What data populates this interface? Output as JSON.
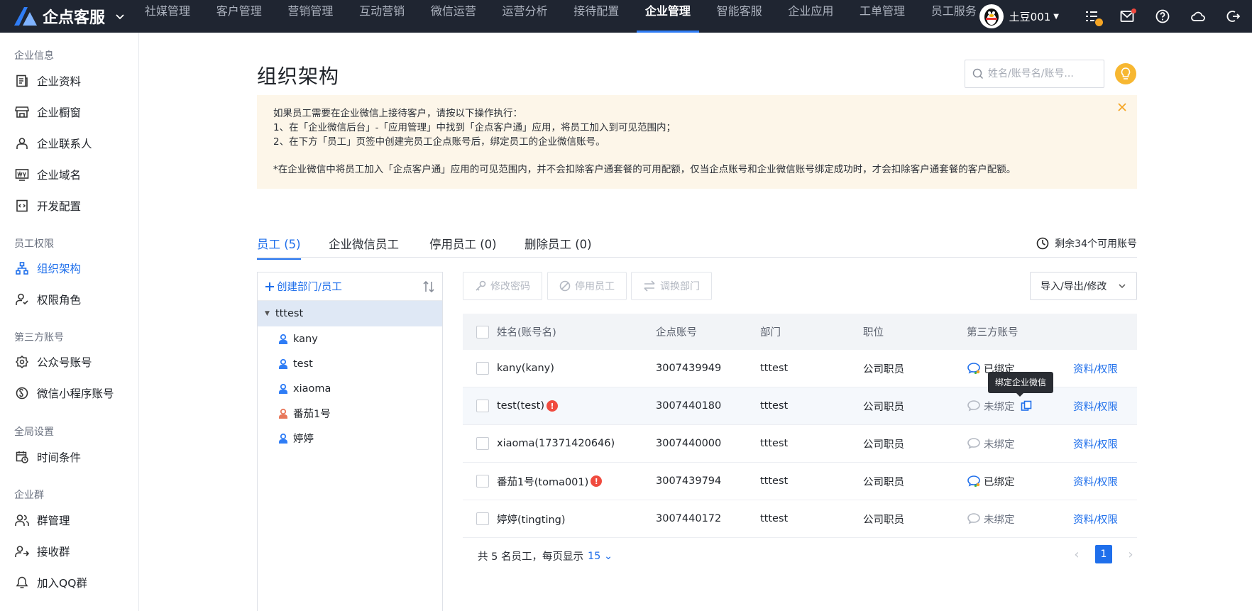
{
  "app": {
    "name": "企点客服"
  },
  "nav": {
    "items": [
      "社媒管理",
      "客户管理",
      "营销管理",
      "互动营销",
      "微信运营",
      "运营分析",
      "接待配置",
      "企业管理",
      "智能客服",
      "企业应用",
      "工单管理",
      "员工服务"
    ],
    "active": "企业管理",
    "username": "土豆001"
  },
  "sidebar": {
    "groups": [
      {
        "title": "企业信息",
        "items": [
          {
            "label": "企业资料",
            "icon": "document-icon"
          },
          {
            "label": "企业橱窗",
            "icon": "storefront-icon"
          },
          {
            "label": "企业联系人",
            "icon": "contact-person-icon"
          },
          {
            "label": "企业域名",
            "icon": "domain-icon"
          },
          {
            "label": "开发配置",
            "icon": "code-icon"
          }
        ]
      },
      {
        "title": "员工权限",
        "items": [
          {
            "label": "组织架构",
            "icon": "org-chart-icon",
            "active": true
          },
          {
            "label": "权限角色",
            "icon": "role-icon"
          }
        ]
      },
      {
        "title": "第三方账号",
        "items": [
          {
            "label": "公众号账号",
            "icon": "official-account-icon"
          },
          {
            "label": "微信小程序账号",
            "icon": "mini-program-icon"
          }
        ]
      },
      {
        "title": "全局设置",
        "items": [
          {
            "label": "时间条件",
            "icon": "calendar-clock-icon"
          }
        ]
      },
      {
        "title": "企业群",
        "items": [
          {
            "label": "群管理",
            "icon": "group-icon"
          },
          {
            "label": "接收群",
            "icon": "receive-group-icon"
          },
          {
            "label": "加入QQ群",
            "icon": "qq-group-icon"
          }
        ]
      }
    ]
  },
  "page": {
    "title": "组织架构",
    "search_placeholder": "姓名/账号名/账号..."
  },
  "notice": {
    "lines": [
      "如果员工需要在企业微信上接待客户，请按以下操作执行：",
      "1、在「企业微信后台」-「应用管理」中找到「企点客户通」应用，将员工加入到可见范围内；",
      "2、在下方「员工」页签中创建完员工企点账号后，绑定员工的企业微信账号。"
    ],
    "footnote": "*在企业微信中将员工加入「企点客户通」应用的可见范围内，并不会扣除客户通套餐的可用配额，仅当企点账号和企业微信账号绑定成功时，才会扣除客户通套餐的客户配额。"
  },
  "tabs": [
    {
      "label": "员工 (5)",
      "active": true
    },
    {
      "label": "企业微信员工"
    },
    {
      "label": "停用员工 (0)"
    },
    {
      "label": "删除员工 (0)"
    }
  ],
  "quota_text": "剩余34个可用账号",
  "tree": {
    "create_label": "创建部门/员工",
    "root": "tttest",
    "members": [
      {
        "name": "kany",
        "color": "#2f7df6"
      },
      {
        "name": "test",
        "color": "#2f7df6"
      },
      {
        "name": "xiaoma",
        "color": "#2f7df6"
      },
      {
        "name": "番茄1号",
        "color": "#e8775a"
      },
      {
        "name": "婷婷",
        "color": "#2f7df6"
      }
    ]
  },
  "toolbar": {
    "change_password": "修改密码",
    "disable_employee": "停用员工",
    "switch_department": "调换部门",
    "import_export": "导入/导出/修改"
  },
  "table": {
    "headers": {
      "name": "姓名(账号名)",
      "account": "企点账号",
      "department": "部门",
      "position": "职位",
      "third_party": "第三方账号"
    },
    "rows": [
      {
        "name": "kany(kany)",
        "warning": false,
        "account": "3007439949",
        "department": "tttest",
        "position": "公司职员",
        "status": "已绑定",
        "bound": true,
        "action": "资料/权限"
      },
      {
        "name": "test(test)",
        "warning": true,
        "account": "3007440180",
        "department": "tttest",
        "position": "公司职员",
        "status": "未绑定",
        "bound": false,
        "show_link": true,
        "action": "资料/权限"
      },
      {
        "name": "xiaoma(17371420646)",
        "warning": false,
        "account": "3007440000",
        "department": "tttest",
        "position": "公司职员",
        "status": "未绑定",
        "bound": false,
        "action": "资料/权限"
      },
      {
        "name": "番茄1号(toma001)",
        "warning": true,
        "account": "3007439794",
        "department": "tttest",
        "position": "公司职员",
        "status": "已绑定",
        "bound": true,
        "action": "资料/权限"
      },
      {
        "name": "婷婷(tingting)",
        "warning": false,
        "account": "3007440172",
        "department": "tttest",
        "position": "公司职员",
        "status": "未绑定",
        "bound": false,
        "action": "资料/权限"
      }
    ]
  },
  "tooltip": "绑定企业微信",
  "footer": {
    "summary": "共 5 名员工，每页显示",
    "page_size": "15",
    "current_page": "1"
  },
  "colors": {
    "accent": "#1f6feb",
    "topbar": "#1f2531",
    "notice_bg": "#fdf6e9",
    "warning": "#f04b3f"
  }
}
